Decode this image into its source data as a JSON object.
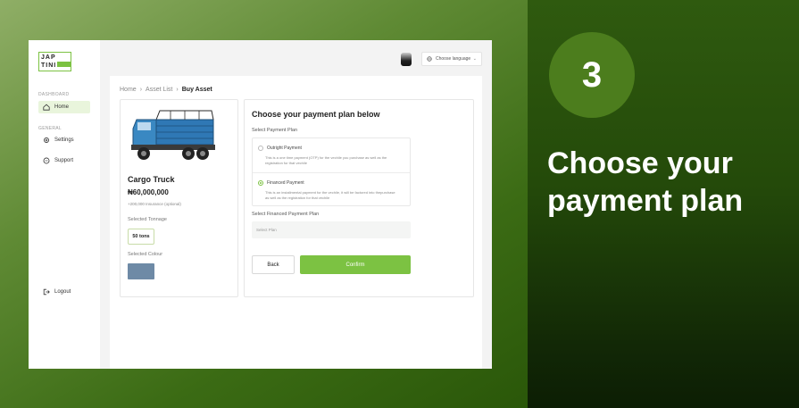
{
  "promo": {
    "step": "3",
    "title": "Choose your payment plan"
  },
  "brand": {
    "logo_line1": "JAP",
    "logo_line2": "TINI",
    "accent": "#7cc242"
  },
  "sidebar": {
    "section_dashboard": "DASHBOARD",
    "section_general": "GENERAL",
    "items": [
      {
        "label": "Home",
        "icon": "home-icon",
        "active": true
      },
      {
        "label": "Settings",
        "icon": "gear-icon",
        "active": false
      },
      {
        "label": "Support",
        "icon": "chat-icon",
        "active": false
      }
    ],
    "logout": "Logout"
  },
  "header": {
    "language_placeholder": "Choose language"
  },
  "breadcrumb": {
    "items": [
      "Home",
      "Asset List",
      "Buy Asset"
    ]
  },
  "asset": {
    "name": "Cargo Truck",
    "price": "₦60,000,000",
    "insurance": "+200,000 Insurance   (optional)",
    "tonnage_label": "Selected Tonnage",
    "tonnage_value": "50 tons",
    "colour_label": "Selected Colour",
    "colour_value": "#6e8aa6"
  },
  "payment": {
    "title": "Choose your payment plan below",
    "select_label": "Select Payment Plan",
    "options": [
      {
        "label": "Outright Payment",
        "desc": "This is a one time payment (OTP) for the vechile you purchase as well as the registration for  that vechile",
        "checked": false
      },
      {
        "label": "Financed Payment",
        "desc": "This is an installmental payment for the vechile, it will be factored into thepurchase as well as the registration for  that vechile",
        "checked": true
      }
    ],
    "financed_label": "Select Financed Payment Plan",
    "financed_placeholder": "Select Plan",
    "back_label": "Back",
    "confirm_label": "Confirm"
  }
}
